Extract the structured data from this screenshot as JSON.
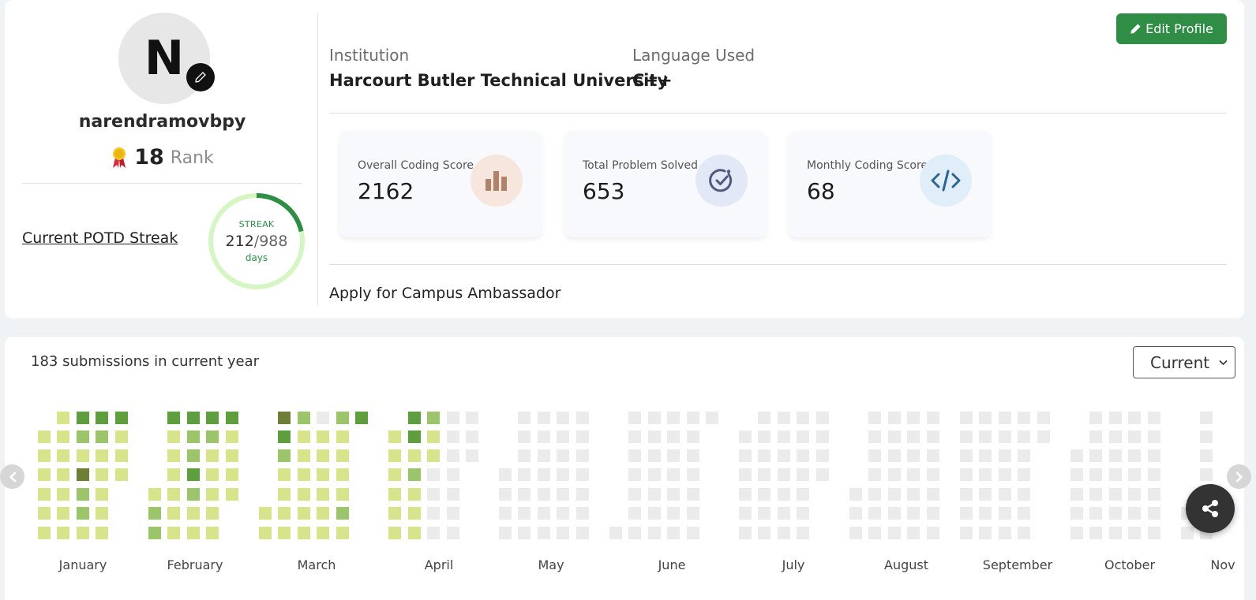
{
  "profile": {
    "avatar_initial": "N",
    "username": "narendramovbpy",
    "rank_value": "18",
    "rank_label": "Rank",
    "potd_label": "Current POTD Streak",
    "streak": {
      "label": "STREAK",
      "current": "212",
      "total": "/988",
      "unit": "days",
      "fraction": 0.215
    }
  },
  "info": {
    "institution_label": "Institution",
    "institution_value": "Harcourt Butler Technical University",
    "language_label": "Language Used",
    "language_value": "C++"
  },
  "edit_profile_label": "Edit Profile",
  "stats": [
    {
      "label": "Overall Coding Score",
      "value": "2162",
      "icon": "bar-chart-icon",
      "icon_bg": "#f6e6dd",
      "icon_color": "#b0826a"
    },
    {
      "label": "Total Problem Solved",
      "value": "653",
      "icon": "check-circle-icon",
      "icon_bg": "#e3e8f6",
      "icon_color": "#51597e"
    },
    {
      "label": "Monthly Coding Score",
      "value": "68",
      "icon": "code-icon",
      "icon_bg": "#dfeef8",
      "icon_color": "#2e6590"
    }
  ],
  "ambassador_link": "Apply for Campus Ambassador",
  "submissions": {
    "summary": "183 submissions in current year",
    "year_select": "Current",
    "months": [
      "January",
      "February",
      "March",
      "April",
      "May",
      "June",
      "July",
      "August",
      "September",
      "October",
      "Nov"
    ]
  },
  "colors": {
    "brand_green": "#2f8d46",
    "heat_levels": [
      "#ebebeb",
      "#d7e48c",
      "#9cc46a",
      "#5e9e3e",
      "#6f7e36"
    ]
  }
}
